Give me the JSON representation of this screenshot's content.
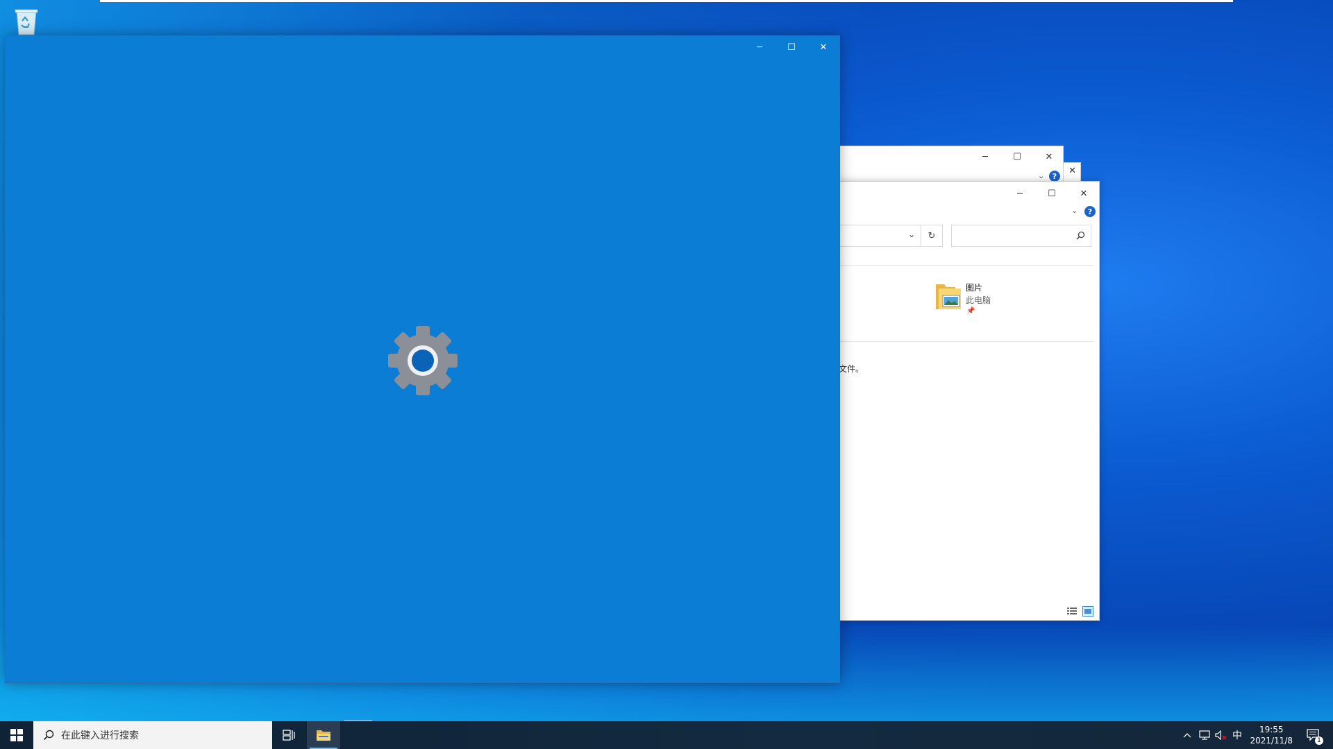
{
  "desktop": {
    "recycle_bin_icon": "recycle-bin-icon"
  },
  "settings_window": {
    "icon": "gear-icon",
    "controls": {
      "minimize": "─",
      "maximize": "☐",
      "close": "✕"
    }
  },
  "explorer_window": {
    "controls": {
      "minimize": "─",
      "maximize": "☐",
      "close": "✕"
    },
    "help": "?",
    "refresh": "↻",
    "folder": {
      "name": "图片",
      "location": "此电脑"
    },
    "partial_text": "文件。"
  },
  "taskbar": {
    "search_placeholder": "在此键入进行搜索",
    "ime": "中",
    "time": "19:55",
    "date": "2021/11/8",
    "notification_count": "1",
    "colors": {
      "search_bg": "#f3f3f3",
      "active_indicator": "#76b9ed"
    }
  }
}
